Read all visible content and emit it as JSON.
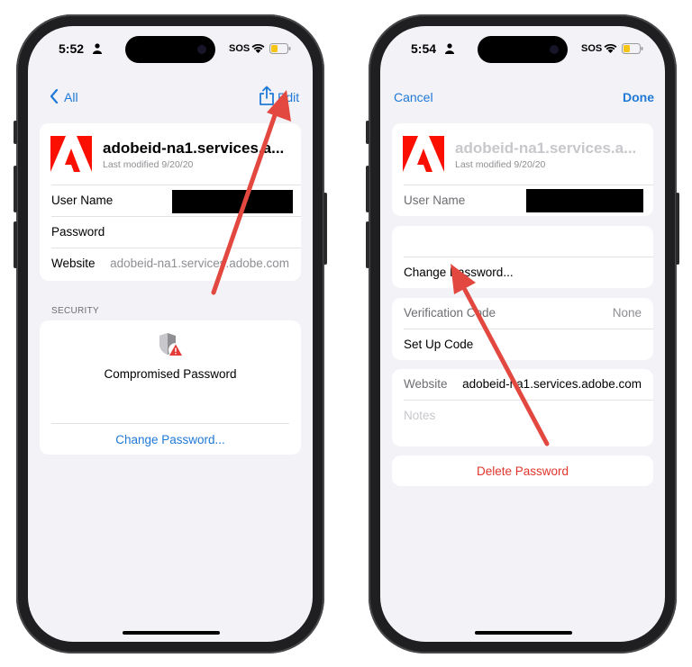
{
  "colors": {
    "link": "#2079d6",
    "destructive": "#e0362c",
    "arrow": "#e2483f",
    "adobe_red": "#ff0000"
  },
  "left": {
    "status": {
      "time": "5:52",
      "person": "person-icon",
      "sos": "SOS"
    },
    "nav": {
      "back_label": "All",
      "share_icon": "share-icon",
      "edit_label": "Edit"
    },
    "account": {
      "title": "adobeid-na1.services.a...",
      "subtitle": "Last modified 9/20/20",
      "logo": "adobe-logo-icon"
    },
    "fields": {
      "username_label": "User Name",
      "password_label": "Password",
      "website_label": "Website",
      "website_value": "adobeid-na1.services.adobe.com"
    },
    "security": {
      "header": "SECURITY",
      "warning_icon": "shield-warning-icon",
      "warning_text": "Compromised Password",
      "change_link": "Change Password..."
    }
  },
  "right": {
    "status": {
      "time": "5:54",
      "person": "person-icon",
      "sos": "SOS"
    },
    "nav": {
      "cancel_label": "Cancel",
      "done_label": "Done"
    },
    "account": {
      "title": "adobeid-na1.services.a...",
      "subtitle": "Last modified 9/20/20",
      "logo": "adobe-logo-icon"
    },
    "fields": {
      "username_label": "User Name",
      "change_link": "Change Password...",
      "verification_label": "Verification Code",
      "verification_value": "None",
      "setup_code": "Set Up Code",
      "website_label": "Website",
      "website_value": "adobeid-na1.services.adobe.com",
      "notes_placeholder": "Notes",
      "delete_label": "Delete Password"
    }
  }
}
